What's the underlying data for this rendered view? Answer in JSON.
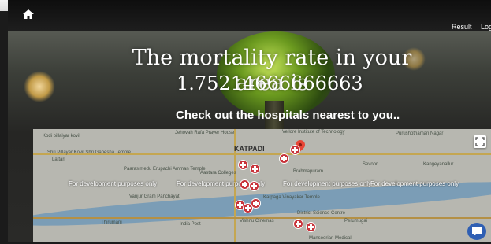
{
  "nav": {
    "result_label": "Result",
    "log_label": "Log"
  },
  "hero": {
    "title": "The mortality rate in your area is",
    "value": "1.75214666666663"
  },
  "subheading": "Check out the hospitals nearest to you..",
  "map": {
    "watermark": "For development purposes only",
    "labels": {
      "katpadi": "KATPADI",
      "vellore_inst": "Vellore Institute of Technology",
      "jehovah": "Jehovah Rafa Prayer House",
      "kodi": "Kodi pillaiyar kovil",
      "ganesha": "Shri Pillayar Kovil Shri Ganesha Temple",
      "lattari": "Lattari",
      "paarasimedu": "Paarasimedu Erupachi Amman Temple",
      "aastara": "Aastara Colleges",
      "brahmapuram": "Brahmapuram",
      "sevoor": "Sevoor",
      "kilpadi": "Vanjur Gram Panchayat",
      "karpaga": "Karpaga Vinayakar Temple",
      "district": "District Science Centre",
      "vishnu": "Vishnu Cinemas",
      "india_post": "India Post",
      "thirumani": "Thirumani",
      "mansoorian": "Mansoorian Medical",
      "perumugai": "Perumugai",
      "purushothaman": "Purushothaman Nagar",
      "kangeyanallur": "Kangeyanallur"
    }
  },
  "colors": {
    "hospital_marker": "#c8333a",
    "location_pin": "#e84636",
    "river": "#8eb8d6"
  }
}
